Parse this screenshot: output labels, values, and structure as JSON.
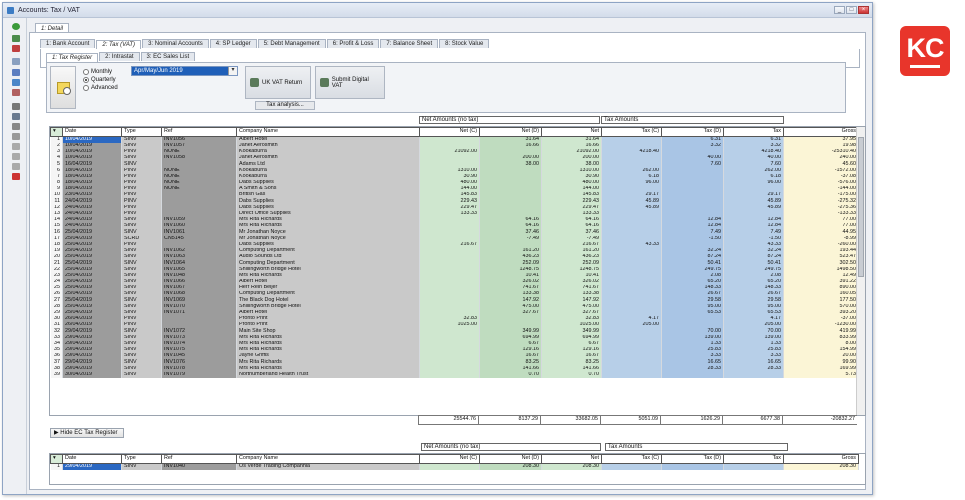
{
  "window": {
    "title": "Accounts: Tax / VAT"
  },
  "tabs": [
    "1: Detail"
  ],
  "main_tabs": [
    "1: Bank Account",
    "2: Tax (VAT)",
    "3: Nominal Accounts",
    "4: SP Ledger",
    "5: Debt Management",
    "6: Profit & Loss",
    "7: Balance Sheet",
    "8: Stock Value"
  ],
  "sub_tabs": [
    "1: Tax Register",
    "2: Intrastat",
    "3: EC Sales List"
  ],
  "period": {
    "options": [
      "Monthly",
      "Quarterly",
      "Advanced"
    ],
    "selected": "Quarterly",
    "value": "Apr/May/Jun 2019"
  },
  "actions": {
    "vat_return": "UK VAT Return",
    "submit": "Submit Digital VAT",
    "analysis": "Tax analysis..."
  },
  "groups": {
    "net": "Net Amounts (no tax)",
    "tax": "Tax Amounts"
  },
  "columns": [
    "Date",
    "Type",
    "Ref",
    "Company Name",
    "Net (C)",
    "Net (D)",
    "Net",
    "Tax (C)",
    "Tax (D)",
    "Tax",
    "Gross"
  ],
  "rows": [
    [
      "1",
      "10/04/2019",
      "SINV",
      "INV1056",
      "Albert Hotel",
      "",
      "31.64",
      "31.64",
      "",
      "6.31",
      "6.31",
      "37.95"
    ],
    [
      "2",
      "10/04/2019",
      "SINV",
      "INV1057",
      "Janet Aerosmith",
      "",
      "16.66",
      "16.66",
      "",
      "3.32",
      "3.32",
      "19.98"
    ],
    [
      "3",
      "10/04/2019",
      "PINV",
      "NONE",
      "Kookaburra",
      "21092.00",
      "",
      "21092.00",
      "4218.40",
      "",
      "4218.40",
      "-25310.40"
    ],
    [
      "4",
      "10/04/2019",
      "SINV",
      "INV1058",
      "Janet Aerosmith",
      "",
      "200.00",
      "200.00",
      "",
      "40.00",
      "40.00",
      "240.00"
    ],
    [
      "5",
      "16/04/2019",
      "SINV",
      "",
      "Adams Ltd",
      "",
      "38.00",
      "38.00",
      "",
      "7.60",
      "7.60",
      "45.60"
    ],
    [
      "6",
      "18/04/2019",
      "PINV",
      "NONE",
      "Kookaburra",
      "1310.00",
      "",
      "1310.00",
      "262.00",
      "",
      "262.00",
      "-1572.00"
    ],
    [
      "7",
      "18/04/2019",
      "PINV",
      "NONE",
      "Kookaburra",
      "30.90",
      "",
      "30.90",
      "6.18",
      "",
      "6.18",
      "-37.08"
    ],
    [
      "8",
      "18/04/2019",
      "PINV",
      "NONE",
      "Dabs Supplies",
      "480.00",
      "",
      "480.00",
      "96.00",
      "",
      "96.00",
      "-576.00"
    ],
    [
      "9",
      "18/04/2019",
      "PINV",
      "NONE",
      "A Smith & Sons",
      "144.00",
      "",
      "144.00",
      "",
      "",
      "",
      "-144.00"
    ],
    [
      "10",
      "23/04/2019",
      "PINV",
      "",
      "British Gas",
      "145.83",
      "",
      "145.83",
      "29.17",
      "",
      "29.17",
      "-175.00"
    ],
    [
      "11",
      "24/04/2019",
      "PINV",
      "",
      "Dabs Supplies",
      "229.43",
      "",
      "229.43",
      "45.89",
      "",
      "45.89",
      "-275.32"
    ],
    [
      "12",
      "24/04/2019",
      "PINV",
      "",
      "Dabs Supplies",
      "229.47",
      "",
      "229.47",
      "45.89",
      "",
      "45.89",
      "-275.36"
    ],
    [
      "13",
      "24/04/2019",
      "PINV",
      "",
      "Direct Office Supplies",
      "133.33",
      "",
      "133.33",
      "",
      "",
      "",
      "-133.33"
    ],
    [
      "14",
      "24/04/2019",
      "SINV",
      "INV1059",
      "Mrs Rita Richards",
      "",
      "64.16",
      "64.16",
      "",
      "12.84",
      "12.84",
      "77.00"
    ],
    [
      "15",
      "24/04/2019",
      "SINV",
      "INV1060",
      "Mrs Rita Richards",
      "",
      "64.16",
      "64.16",
      "",
      "12.84",
      "12.84",
      "77.00"
    ],
    [
      "16",
      "25/04/2019",
      "SINV",
      "INV1061",
      "Mr Jonathan Noyce",
      "",
      "37.46",
      "37.46",
      "",
      "7.49",
      "7.49",
      "44.95"
    ],
    [
      "17",
      "25/04/2019",
      "SCRD",
      "CN5145",
      "Mr Jonathan Noyce",
      "",
      "-7.49",
      "-7.49",
      "",
      "-1.50",
      "-1.50",
      "-8.99"
    ],
    [
      "18",
      "25/04/2019",
      "PINV",
      "",
      "Dabs Supplies",
      "216.67",
      "",
      "216.67",
      "43.33",
      "",
      "43.33",
      "-260.00"
    ],
    [
      "19",
      "25/04/2019",
      "SINV",
      "INV1062",
      "Computing Department",
      "",
      "161.20",
      "161.20",
      "",
      "32.24",
      "32.24",
      "193.44"
    ],
    [
      "20",
      "25/04/2019",
      "SINV",
      "INV1063",
      "Audio Sounds Ltd",
      "",
      "436.23",
      "436.23",
      "",
      "87.24",
      "87.24",
      "523.47"
    ],
    [
      "21",
      "25/04/2019",
      "SINV",
      "INV1064",
      "Computing Department",
      "",
      "252.09",
      "252.09",
      "",
      "50.41",
      "50.41",
      "302.50"
    ],
    [
      "22",
      "25/04/2019",
      "SINV",
      "INV1065",
      "Shillingworth Bridge Hotel",
      "",
      "1248.75",
      "1248.75",
      "",
      "249.75",
      "249.75",
      "1498.50"
    ],
    [
      "23",
      "25/04/2019",
      "SINV",
      "INV1048",
      "Mrs Rita Richards",
      "",
      "10.41",
      "10.41",
      "",
      "2.08",
      "2.08",
      "12.49"
    ],
    [
      "24",
      "25/04/2019",
      "SINV",
      "INV1066",
      "Albert Hotel",
      "",
      "326.02",
      "326.02",
      "",
      "65.20",
      "65.20",
      "391.22"
    ],
    [
      "25",
      "25/04/2019",
      "SINV",
      "INV1067",
      "Herr Rein Beijer",
      "",
      "741.67",
      "741.67",
      "",
      "148.33",
      "148.33",
      "890.00"
    ],
    [
      "26",
      "25/04/2019",
      "SINV",
      "INV1068",
      "Computing Department",
      "",
      "133.38",
      "133.38",
      "",
      "26.67",
      "26.67",
      "160.05"
    ],
    [
      "27",
      "25/04/2019",
      "SINV",
      "INV1069",
      "The Black Dog Hotel",
      "",
      "147.92",
      "147.92",
      "",
      "29.58",
      "29.58",
      "177.50"
    ],
    [
      "28",
      "25/04/2019",
      "SINV",
      "INV1070",
      "Shillingworth Bridge Hotel",
      "",
      "475.00",
      "475.00",
      "",
      "95.00",
      "95.00",
      "570.00"
    ],
    [
      "29",
      "25/04/2019",
      "SINV",
      "INV1071",
      "Albert Hotel",
      "",
      "327.67",
      "327.67",
      "",
      "65.53",
      "65.53",
      "393.20"
    ],
    [
      "30",
      "26/04/2019",
      "PINV",
      "",
      "Pronto Print",
      "32.83",
      "",
      "32.83",
      "4.17",
      "",
      "4.17",
      "-37.00"
    ],
    [
      "31",
      "26/04/2019",
      "PINV",
      "",
      "Pronto Print",
      "1025.00",
      "",
      "1025.00",
      "205.00",
      "",
      "205.00",
      "-1230.00"
    ],
    [
      "32",
      "29/04/2019",
      "SINV",
      "INV1072",
      "Main Site Shop",
      "",
      "349.99",
      "349.99",
      "",
      "70.00",
      "70.00",
      "419.99"
    ],
    [
      "33",
      "29/04/2019",
      "SINV",
      "INV1073",
      "Mrs Rita Richards",
      "",
      "694.99",
      "694.99",
      "",
      "139.00",
      "139.00",
      "833.99"
    ],
    [
      "34",
      "29/04/2019",
      "SINV",
      "INV1074",
      "Mrs Rita Richards",
      "",
      "6.67",
      "6.67",
      "",
      "1.33",
      "1.33",
      "8.00"
    ],
    [
      "35",
      "29/04/2019",
      "SINV",
      "INV1075",
      "Mrs Rita Richards",
      "",
      "129.16",
      "129.16",
      "",
      "25.83",
      "25.83",
      "154.99"
    ],
    [
      "36",
      "29/04/2019",
      "SINV",
      "INV1045",
      "Jayne Griffis",
      "",
      "16.67",
      "16.67",
      "",
      "3.33",
      "3.33",
      "20.00"
    ],
    [
      "37",
      "29/04/2019",
      "SINV",
      "INV1076",
      "Mrs Rita Richards",
      "",
      "83.25",
      "83.25",
      "",
      "16.65",
      "16.65",
      "99.90"
    ],
    [
      "38",
      "29/04/2019",
      "SINV",
      "INV1078",
      "Mrs Rita Richards",
      "",
      "141.66",
      "141.66",
      "",
      "28.33",
      "28.33",
      "169.99"
    ],
    [
      "39",
      "30/04/2019",
      "SINV",
      "INV1079",
      "Northumberland Health Trust",
      "",
      "0.70",
      "0.70",
      "",
      "",
      "",
      "5.73"
    ]
  ],
  "totals": [
    "",
    "",
    "",
    "",
    "25544.76",
    "8137.29",
    "33682.05",
    "5051.09",
    "1626.29",
    "6677.38",
    "-20832.27"
  ],
  "hide_btn": "Hide EC Tax Register",
  "ec_rows": [
    [
      "1",
      "29/04/2019",
      "SINV",
      "INV1040",
      "Os Verde Trading Companhia",
      "",
      "208.30",
      "208.30",
      "",
      "",
      "",
      "208.30"
    ]
  ],
  "ec_totals": [
    "0.00",
    "208.30",
    "208.30",
    "0.00",
    "0.00",
    "0.00",
    "208.30"
  ],
  "logo": "KC"
}
